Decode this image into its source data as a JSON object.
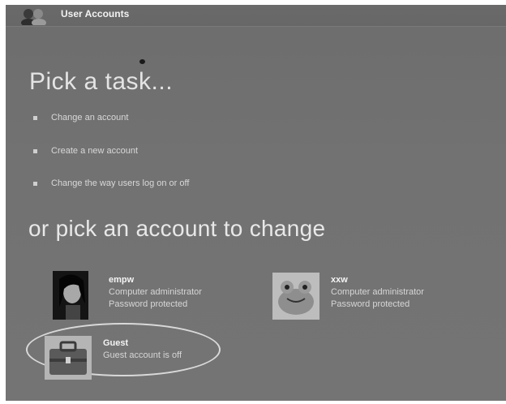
{
  "window": {
    "title": "User Accounts"
  },
  "tasks": {
    "heading": "Pick a task...",
    "items": [
      {
        "label": "Change an account"
      },
      {
        "label": "Create a new account"
      },
      {
        "label": "Change the way users log on or off"
      }
    ]
  },
  "accounts": {
    "heading": "or pick an account to change",
    "items": [
      {
        "name": "empw",
        "line1": "Computer administrator",
        "line2": "Password protected",
        "picture": "portrait-photo"
      },
      {
        "name": "xxw",
        "line1": "Computer administrator",
        "line2": "Password protected",
        "picture": "frog-icon"
      },
      {
        "name": "Guest",
        "line1": "Guest account is off",
        "picture": "briefcase-icon",
        "highlighted": true
      }
    ]
  }
}
